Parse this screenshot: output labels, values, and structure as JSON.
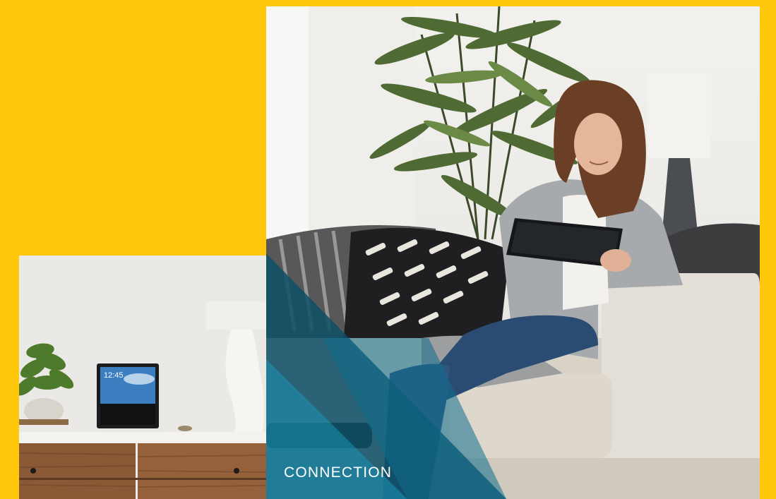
{
  "caption": {
    "text": "CONNECTION"
  },
  "device_screen": {
    "clock": "12:45"
  },
  "colors": {
    "background_yellow": "#FFC709",
    "teal_dark": "#0d4f66",
    "teal_mid": "#0e6e8c",
    "teal_light": "#1a93b4"
  }
}
